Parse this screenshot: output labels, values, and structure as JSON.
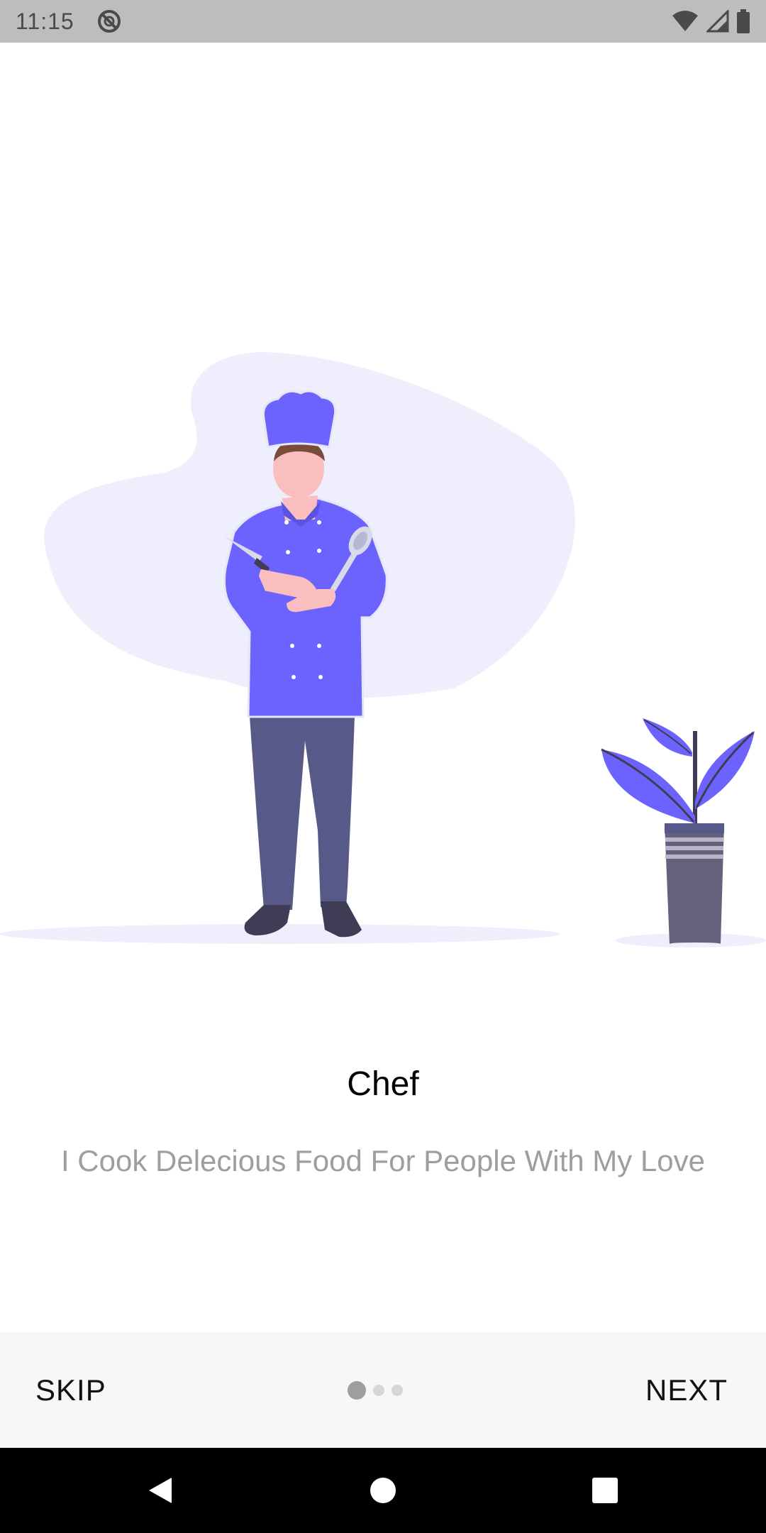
{
  "status_bar": {
    "time": "11:15",
    "icons": [
      "data-saver-icon",
      "wifi-icon",
      "signal-icon",
      "battery-icon"
    ]
  },
  "onboarding": {
    "title": "Chef",
    "subtitle": "I Cook Delecious Food For People With My Love",
    "illustration": "chef-illustration",
    "page_indicator": {
      "current": 1,
      "total": 3
    }
  },
  "bottom_bar": {
    "skip_label": "SKIP",
    "next_label": "NEXT"
  },
  "nav_bar": {
    "icons": [
      "back-icon",
      "home-icon",
      "recents-icon"
    ]
  },
  "colors": {
    "accent": "#6c63ff",
    "blob": "#efeefd",
    "pants": "#575a89",
    "subtitle": "#9e9e9e",
    "status_bar": "#bdbdbd"
  }
}
